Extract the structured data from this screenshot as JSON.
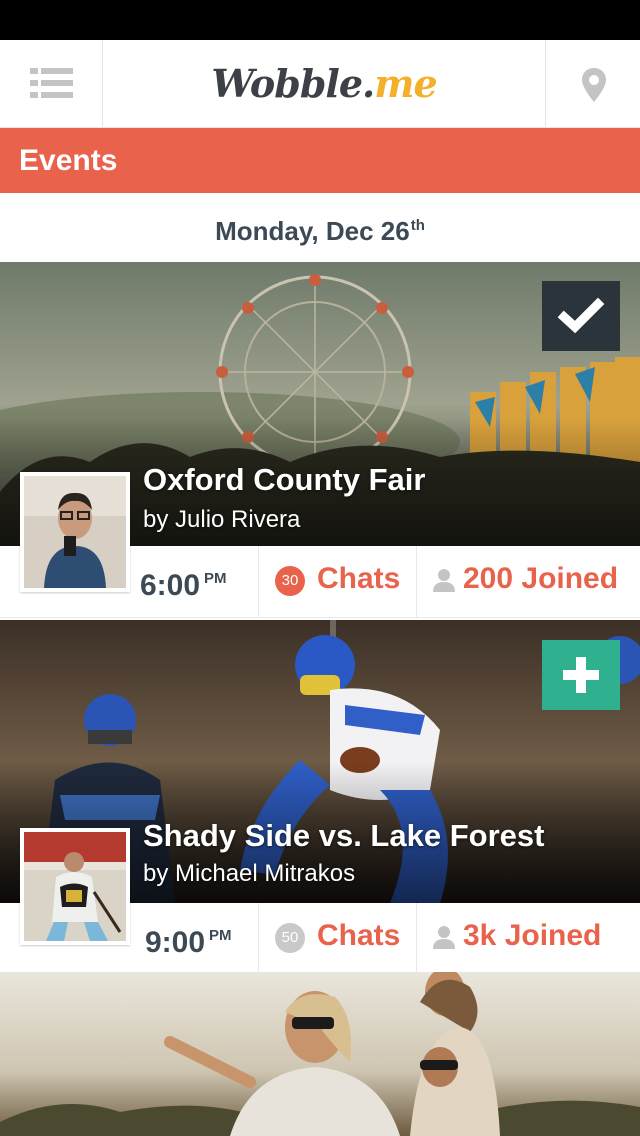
{
  "app": {
    "logo_main": "Wobble.",
    "logo_accent": "me"
  },
  "header": {
    "title": "Events"
  },
  "date": {
    "label": "Monday, Dec 26",
    "suffix": "th"
  },
  "events": [
    {
      "title": "Oxford County Fair",
      "host": "by Julio Rivera",
      "time": "6:00",
      "period": "PM",
      "chat_count": "30",
      "chats_label": "Chats",
      "joined_label": "200 Joined",
      "action": "check-icon",
      "badge_color": "#e9624c"
    },
    {
      "title": "Shady Side vs. Lake Forest",
      "host": "by Michael Mitrakos",
      "time": "9:00",
      "period": "PM",
      "chat_count": "50",
      "chats_label": "Chats",
      "joined_label": "3k Joined",
      "action": "plus-icon",
      "badge_color": "#c9c9c9"
    }
  ],
  "colors": {
    "accent": "#e9624c",
    "logo_accent": "#f3b12b",
    "check_button": "#2c343b",
    "add_button": "#2fb18f",
    "text_dark": "#3d4a56"
  }
}
